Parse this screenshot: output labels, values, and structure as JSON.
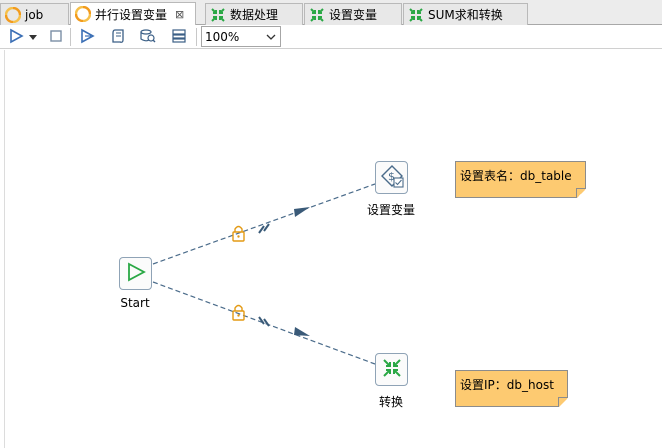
{
  "tabs": [
    {
      "label": "job",
      "icon": "job-icon",
      "active": false
    },
    {
      "label": "并行设置变量",
      "icon": "job-icon",
      "active": true,
      "close": "⊠"
    },
    {
      "label": "数据处理",
      "icon": "transformation-icon",
      "active": false
    },
    {
      "label": "设置变量",
      "icon": "transformation-icon",
      "active": false
    },
    {
      "label": "SUM求和转换",
      "icon": "transformation-icon",
      "active": false
    }
  ],
  "toolbar": {
    "zoom_value": "100%"
  },
  "nodes": {
    "start": {
      "label": "Start"
    },
    "set_var": {
      "label": "设置变量"
    },
    "transform": {
      "label": "转换"
    }
  },
  "notes": {
    "note1": "设置表名：db_table",
    "note2": "设置IP：db_host"
  },
  "colors": {
    "hop_line": "#4a6b8a",
    "lock": "#e39a14",
    "start_green": "#2aa845",
    "note_bg": "#fdca71"
  }
}
